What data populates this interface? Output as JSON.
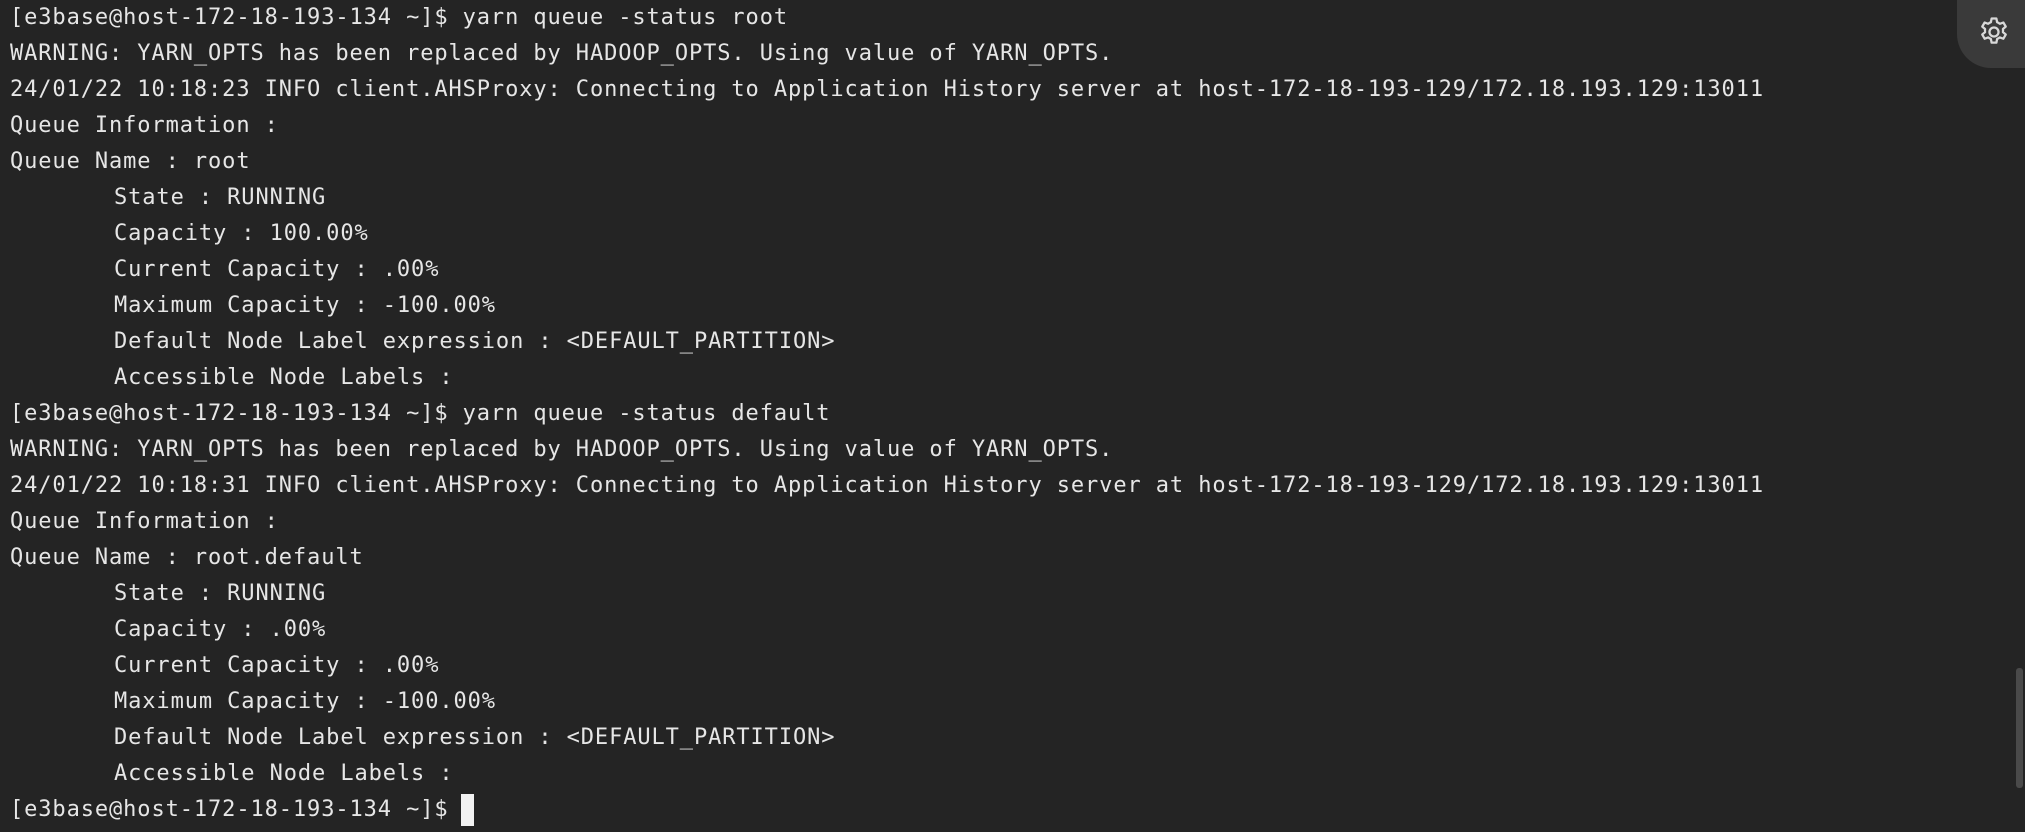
{
  "terminal": {
    "lines": [
      {
        "text": "[e3base@host-172-18-193-134 ~]$ yarn queue -status root",
        "indent": false
      },
      {
        "text": "WARNING: YARN_OPTS has been replaced by HADOOP_OPTS. Using value of YARN_OPTS.",
        "indent": false
      },
      {
        "text": "24/01/22 10:18:23 INFO client.AHSProxy: Connecting to Application History server at host-172-18-193-129/172.18.193.129:13011",
        "indent": false
      },
      {
        "text": "Queue Information :",
        "indent": false
      },
      {
        "text": "Queue Name : root",
        "indent": false
      },
      {
        "text": "State : RUNNING",
        "indent": true
      },
      {
        "text": "Capacity : 100.00%",
        "indent": true
      },
      {
        "text": "Current Capacity : .00%",
        "indent": true
      },
      {
        "text": "Maximum Capacity : -100.00%",
        "indent": true
      },
      {
        "text": "Default Node Label expression : <DEFAULT_PARTITION>",
        "indent": true
      },
      {
        "text": "Accessible Node Labels :",
        "indent": true
      },
      {
        "text": "[e3base@host-172-18-193-134 ~]$ yarn queue -status default",
        "indent": false
      },
      {
        "text": "WARNING: YARN_OPTS has been replaced by HADOOP_OPTS. Using value of YARN_OPTS.",
        "indent": false
      },
      {
        "text": "24/01/22 10:18:31 INFO client.AHSProxy: Connecting to Application History server at host-172-18-193-129/172.18.193.129:13011",
        "indent": false
      },
      {
        "text": "Queue Information :",
        "indent": false
      },
      {
        "text": "Queue Name : root.default",
        "indent": false
      },
      {
        "text": "State : RUNNING",
        "indent": true
      },
      {
        "text": "Capacity : .00%",
        "indent": true
      },
      {
        "text": "Current Capacity : .00%",
        "indent": true
      },
      {
        "text": "Maximum Capacity : -100.00%",
        "indent": true
      },
      {
        "text": "Default Node Label expression : <DEFAULT_PARTITION>",
        "indent": true
      },
      {
        "text": "Accessible Node Labels :",
        "indent": true
      }
    ],
    "prompt": "[e3base@host-172-18-193-134 ~]$"
  },
  "settings": {
    "icon": "gear-icon"
  },
  "colors": {
    "background": "#242424",
    "text": "#e6e6e6",
    "cursor": "#f2f2f2",
    "settings_bg": "#3a3a3a"
  }
}
